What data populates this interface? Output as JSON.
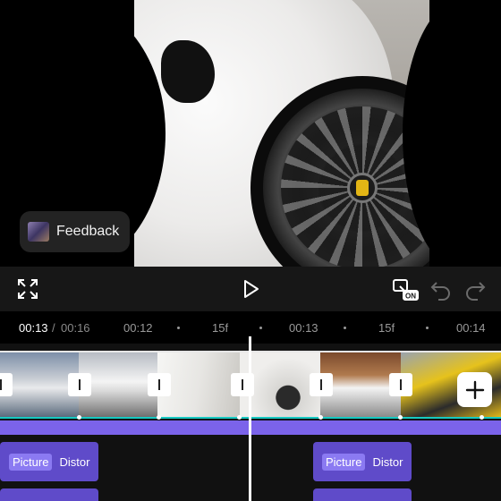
{
  "preview": {
    "feedback_label": "Feedback"
  },
  "controls": {
    "fullscreen_icon": "fullscreen-icon",
    "play_icon": "play-icon",
    "keyframe_toggle_badge": "ON",
    "undo_icon": "undo-icon",
    "redo_icon": "redo-icon"
  },
  "ruler": {
    "current_time": "00:13",
    "separator": "/",
    "total_time": "00:16",
    "ticks": [
      "00:12",
      "15f",
      "00:13",
      "15f",
      "00:14"
    ]
  },
  "timeline": {
    "effects": [
      {
        "tag": "Picture",
        "name": "Distor"
      },
      {
        "tag": "Picture",
        "name": "Distor"
      }
    ]
  },
  "colors": {
    "accent_purple": "#7b63ea",
    "effect_clip": "#5f4bc9",
    "main_track_line": "#17c9c1"
  }
}
